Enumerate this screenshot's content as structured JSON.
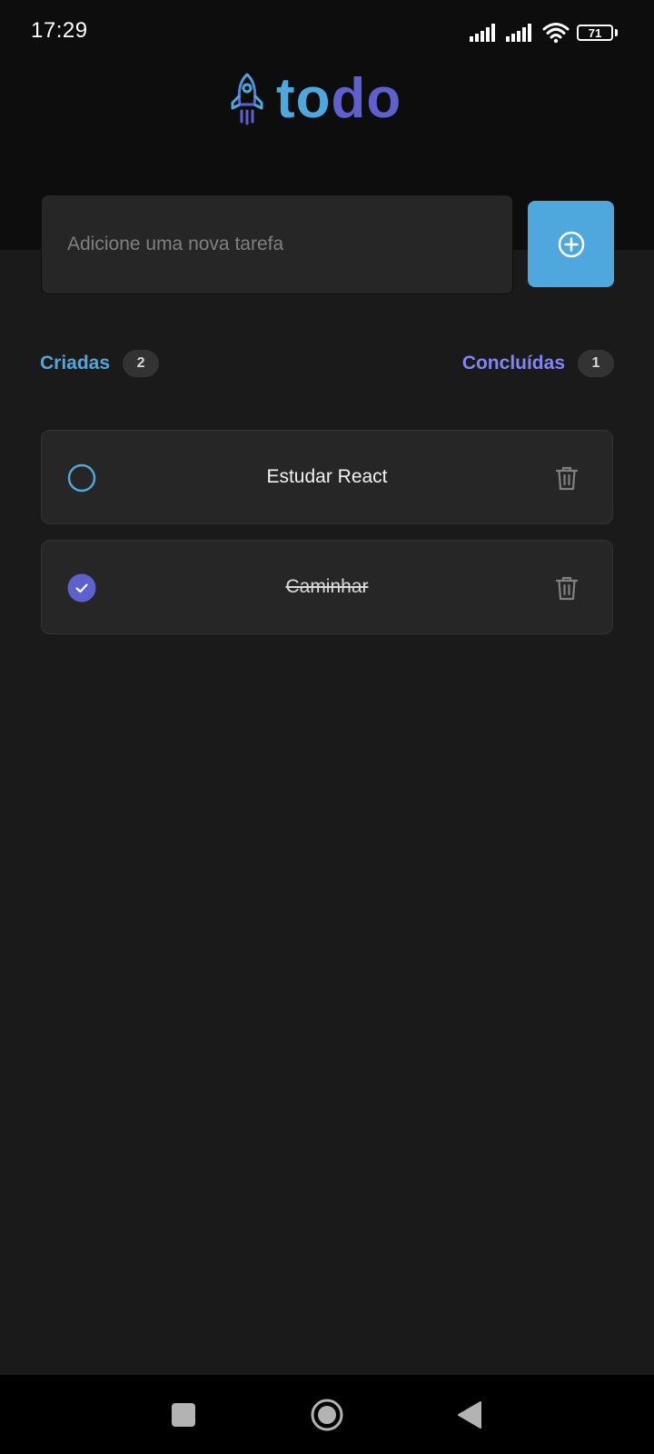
{
  "status_bar": {
    "time": "17:29",
    "battery": "71",
    "icons": [
      "signal-icon",
      "signal-icon",
      "wifi-icon",
      "battery-icon"
    ]
  },
  "app": {
    "logo_part1": "to",
    "logo_part2": "do",
    "logo_icon": "rocket-icon"
  },
  "input": {
    "placeholder": "Adicione uma nova tarefa",
    "value": "",
    "add_icon": "plus-circle-icon"
  },
  "counters": {
    "created_label": "Criadas",
    "created_count": "2",
    "done_label": "Concluídas",
    "done_count": "1"
  },
  "tasks": [
    {
      "text": "Estudar React",
      "completed": false
    },
    {
      "text": "Caminhar",
      "completed": true
    }
  ],
  "nav_bar": {
    "icons": [
      "recents-square-icon",
      "home-circle-icon",
      "back-triangle-icon"
    ]
  },
  "colors": {
    "blue": "#4ea8de",
    "purple": "#5e60ce",
    "purple_light": "#8284fa",
    "background": "#1a1a1a",
    "header": "#0d0d0d",
    "card": "#262626"
  }
}
